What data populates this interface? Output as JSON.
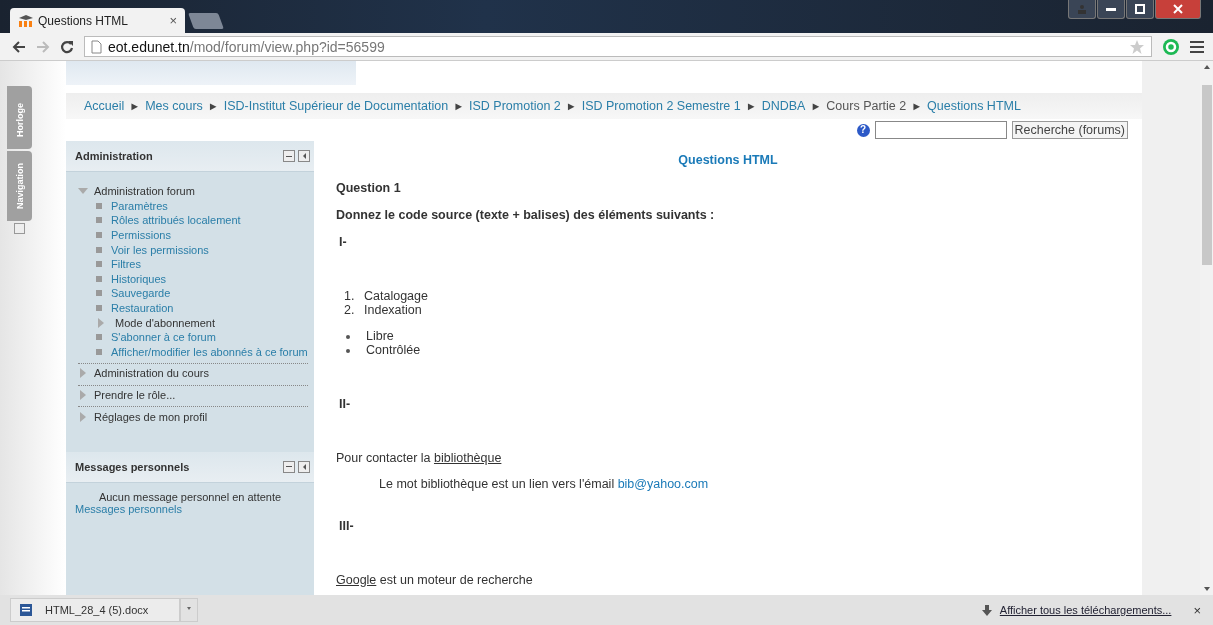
{
  "browser": {
    "tab_title": "Questions HTML",
    "tab_close": "×",
    "url_host": "eot.edunet.tn",
    "url_path": "/mod/forum/view.php?id=56599"
  },
  "side_tabs": [
    "Horloge",
    "Navigation"
  ],
  "breadcrumb": [
    {
      "label": "Accueil",
      "link": true
    },
    {
      "label": "Mes cours",
      "link": true
    },
    {
      "label": "ISD-Institut Supérieur de Documentation",
      "link": true
    },
    {
      "label": "ISD Promotion 2",
      "link": true
    },
    {
      "label": "ISD Promotion 2 Semestre 1",
      "link": true
    },
    {
      "label": "DNDBA",
      "link": true
    },
    {
      "label": "Cours Partie 2",
      "link": false
    },
    {
      "label": "Questions HTML",
      "link": true
    }
  ],
  "breadcrumb_separator": "►",
  "search": {
    "help": "?",
    "button": "Recherche (forums)"
  },
  "administration": {
    "title": "Administration",
    "items": [
      {
        "label": "Administration forum",
        "kind": "branch",
        "expanded": true,
        "children": [
          {
            "label": "Paramètres",
            "kind": "leaf"
          },
          {
            "label": "Rôles attribués localement",
            "kind": "leaf"
          },
          {
            "label": "Permissions",
            "kind": "leaf"
          },
          {
            "label": "Voir les permissions",
            "kind": "leaf"
          },
          {
            "label": "Filtres",
            "kind": "leaf"
          },
          {
            "label": "Historiques",
            "kind": "leaf"
          },
          {
            "label": "Sauvegarde",
            "kind": "leaf"
          },
          {
            "label": "Restauration",
            "kind": "leaf"
          },
          {
            "label": "Mode d'abonnement",
            "kind": "branch",
            "expanded": false
          },
          {
            "label": "S'abonner à ce forum",
            "kind": "leaf"
          },
          {
            "label": "Afficher/modifier les abonnés à ce forum",
            "kind": "leaf"
          }
        ]
      },
      {
        "label": "Administration du cours",
        "kind": "branch",
        "expanded": false
      },
      {
        "label": "Prendre le rôle...",
        "kind": "branch",
        "expanded": false
      },
      {
        "label": "Réglages de mon profil",
        "kind": "branch",
        "expanded": false
      }
    ]
  },
  "messages": {
    "title": "Messages personnels",
    "text": "Aucun message personnel en attente",
    "link": "Messages personnels"
  },
  "main": {
    "title": "Questions HTML",
    "question": "Question 1",
    "instruction": "Donnez le code source (texte + balises) des éléments suivants :",
    "blocks": [
      {
        "kind": "label",
        "text": "I-"
      },
      {
        "kind": "ol",
        "items": [
          {
            "number": "1.",
            "text": "Catalogage"
          },
          {
            "number": "2.",
            "text": "Indexation"
          }
        ]
      },
      {
        "kind": "ul",
        "items": [
          "Libre",
          "Contrôlée"
        ]
      },
      {
        "kind": "label",
        "text": "II-"
      },
      {
        "kind": "sentence",
        "before": "Pour contacter la ",
        "link": "bibliothèque"
      },
      {
        "kind": "note",
        "before": "Le mot bibliothèque est un lien vers l'émail ",
        "link": "bib@yahoo.com"
      },
      {
        "kind": "label",
        "text": "III-"
      },
      {
        "kind": "sentence",
        "link": "Google",
        "after": " est un moteur de recherche"
      }
    ]
  },
  "downloads": {
    "file": "HTML_28_4 (5).docx",
    "show_all": "Afficher tous les téléchargements...",
    "close": "×"
  }
}
